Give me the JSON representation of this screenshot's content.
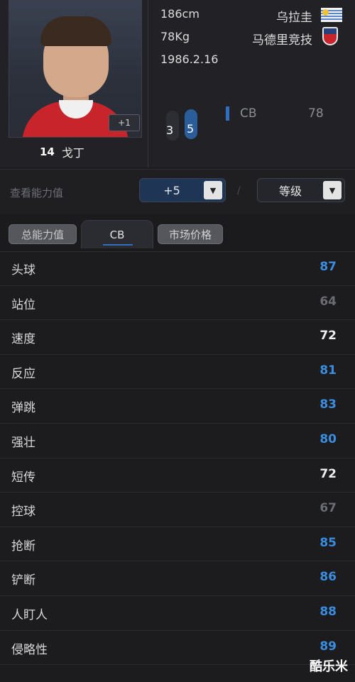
{
  "player": {
    "plus_badge": "+1",
    "jersey_number": "14",
    "name": "戈丁",
    "height": "186cm",
    "weight": "78Kg",
    "birth_date": "1986.2.16",
    "country": "乌拉圭",
    "club": "马德里竞技",
    "foot_left": "3",
    "foot_right": "5",
    "position": "CB",
    "position_rating": "78"
  },
  "selector": {
    "label": "查看能力值",
    "plus_value": "+5",
    "grade": "等级"
  },
  "tabs": [
    {
      "label": "总能力值"
    },
    {
      "label": "CB",
      "active": true
    },
    {
      "label": "市场价格"
    }
  ],
  "stats": [
    {
      "name": "头球",
      "value": "87",
      "color": "#3b8de0"
    },
    {
      "name": "站位",
      "value": "64",
      "color": "#6b6d73"
    },
    {
      "name": "速度",
      "value": "72",
      "color": "#eeeeee"
    },
    {
      "name": "反应",
      "value": "81",
      "color": "#3b8de0"
    },
    {
      "name": "弹跳",
      "value": "83",
      "color": "#3b8de0"
    },
    {
      "name": "强壮",
      "value": "80",
      "color": "#3b8de0"
    },
    {
      "name": "短传",
      "value": "72",
      "color": "#eeeeee"
    },
    {
      "name": "控球",
      "value": "67",
      "color": "#6b6d73"
    },
    {
      "name": "抢断",
      "value": "85",
      "color": "#3b8de0"
    },
    {
      "name": "铲断",
      "value": "86",
      "color": "#3b8de0"
    },
    {
      "name": "人盯人",
      "value": "88",
      "color": "#3b8de0"
    },
    {
      "name": "侵略性",
      "value": "89",
      "color": "#3b8de0"
    }
  ],
  "watermark": "酷乐米",
  "icons": {
    "flag": "uruguay-flag-icon",
    "crest": "atletico-madrid-crest-icon",
    "dropdown": "triangle-down-icon",
    "feet": "feet-icon"
  }
}
